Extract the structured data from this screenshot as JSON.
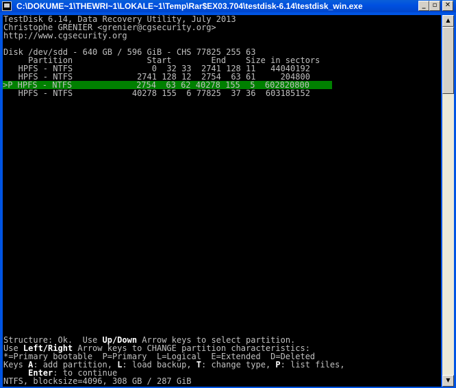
{
  "window": {
    "title": "C:\\DOKUME~1\\THEWRI~1\\LOKALE~1\\Temp\\Rar$EX03.704\\testdisk-6.14\\testdisk_win.exe",
    "minimize": "_",
    "maximize": "▫",
    "close": "✕"
  },
  "console": {
    "header": [
      "TestDisk 6.14, Data Recovery Utility, July 2013",
      "Christophe GRENIER <grenier@cgsecurity.org>",
      "http://www.cgsecurity.org"
    ],
    "disk_line": "Disk /dev/sdd - 640 GB / 596 GiB - CHS 77825 255 63",
    "table_header": "     Partition               Start        End    Size in sectors",
    "partitions": [
      {
        "text": "   HPFS - NTFS                0  32 33  2741 128 11   44040192",
        "selected": false
      },
      {
        "text": "   HPFS - NTFS             2741 128 12  2754  63 61     204800",
        "selected": false
      },
      {
        "text": ">P HPFS - NTFS             2754  63 62 40278 155  5  602820800",
        "selected": true
      },
      {
        "text": "   HPFS - NTFS            40278 155  6 77825  37 36  603185152",
        "selected": false
      }
    ],
    "footer": {
      "l1_a": "Structure: Ok.  Use ",
      "l1_b": "Up/Down",
      "l1_c": " Arrow keys to select partition.",
      "l2_a": "Use ",
      "l2_b": "Left/Right",
      "l2_c": " Arrow keys to CHANGE partition characteristics:",
      "l3": "*=Primary bootable  P=Primary  L=Logical  E=Extended  D=Deleted",
      "l4_a": "Keys ",
      "l4_b": "A",
      "l4_c": ": add partition, ",
      "l4_d": "L",
      "l4_e": ": load backup, ",
      "l4_f": "T",
      "l4_g": ": change type, ",
      "l4_h": "P",
      "l4_i": ": list files,",
      "l5_a": "     ",
      "l5_b": "Enter",
      "l5_c": ": to continue",
      "l6": "NTFS, blocksize=4096, 308 GB / 287 GiB"
    }
  },
  "scrollbar": {
    "up": "▲",
    "down": "▼"
  }
}
